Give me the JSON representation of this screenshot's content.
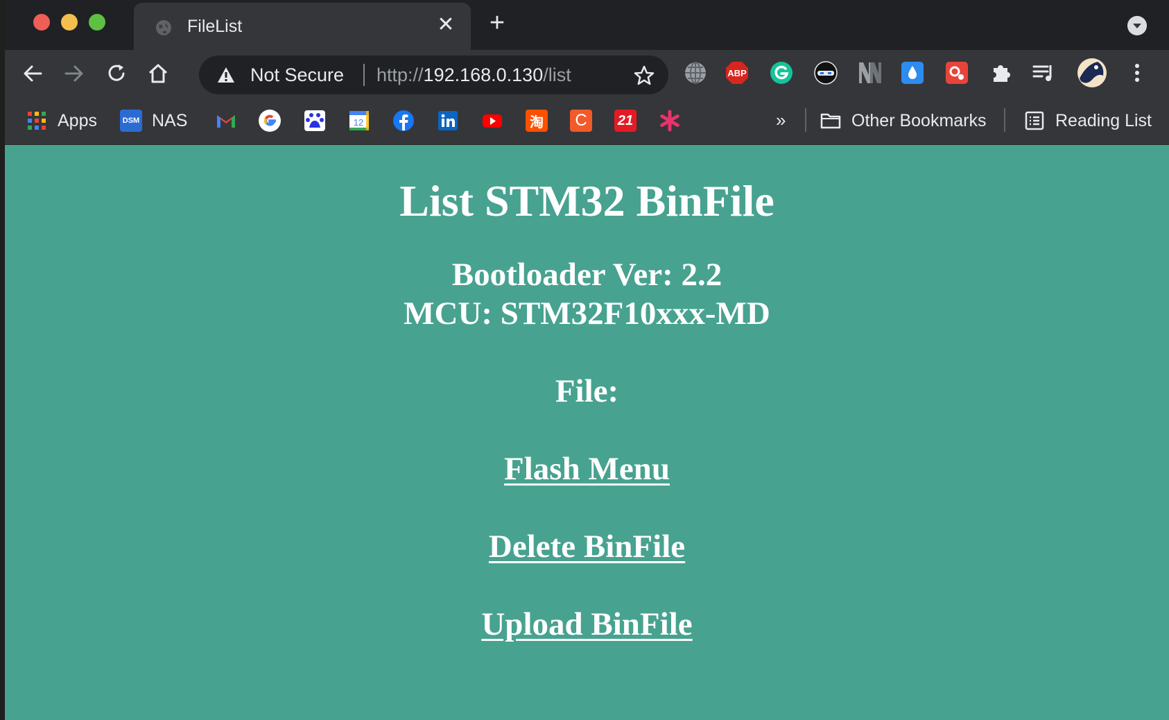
{
  "tab": {
    "title": "FileList",
    "close_glyph": "✕",
    "new_tab_glyph": "+"
  },
  "omnibox": {
    "security_label": "Not Secure",
    "url_scheme": "http://",
    "url_host": "192.168.0.130",
    "url_path": "/list"
  },
  "extensions": [
    {
      "name": "globe-extension-icon"
    },
    {
      "name": "adblock-plus-icon",
      "text": "ABP"
    },
    {
      "name": "grammarly-icon"
    },
    {
      "name": "ninja-extension-icon"
    },
    {
      "name": "nn-extension-icon"
    },
    {
      "name": "raindrop-icon"
    },
    {
      "name": "red-settings-extension-icon"
    },
    {
      "name": "extensions-puzzle-icon"
    },
    {
      "name": "reading-list-queue-icon"
    },
    {
      "name": "profile-avatar"
    }
  ],
  "bookmarks": {
    "apps_label": "Apps",
    "nas_label": "NAS",
    "nas_icon_text": "DSM",
    "calendar_icon_text": "12",
    "taobao_icon_text": "淘",
    "c_icon_text": "C",
    "n21_icon_text": "21",
    "overflow_glyph": "»",
    "other_bookmarks_label": "Other Bookmarks",
    "reading_list_label": "Reading List"
  },
  "page": {
    "title": "List STM32 BinFile",
    "bootloader": "Bootloader Ver: 2.2",
    "mcu": "MCU: STM32F10xxx-MD",
    "file_label": "File:",
    "links": {
      "flash_menu": "Flash Menu",
      "delete_binfile": "Delete BinFile",
      "upload_binfile": "Upload BinFile"
    }
  },
  "colors": {
    "page_background": "#48a290",
    "browser_chrome": "#35363a",
    "tab_strip": "#202124"
  }
}
